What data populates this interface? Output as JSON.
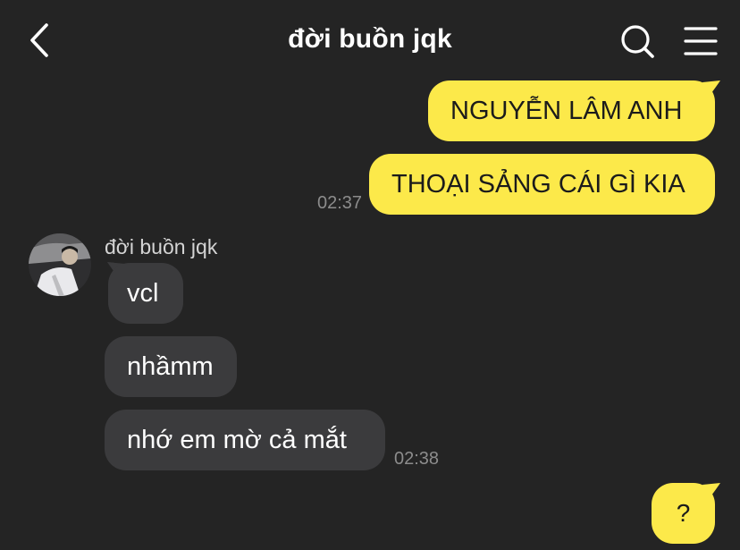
{
  "header": {
    "title": "đời buồn jqk",
    "back_icon": "chevron-left-icon",
    "search_icon": "search-icon",
    "menu_icon": "hamburger-menu-icon"
  },
  "messages": {
    "outgoing": [
      {
        "text": "NGUYỄN LÂM ANH"
      },
      {
        "text": "THOẠI SẢNG CÁI GÌ KIA",
        "time": "02:37"
      }
    ],
    "incoming_sender": "đời buồn jqk",
    "incoming": [
      {
        "text": "vcl"
      },
      {
        "text": "nhầmm"
      },
      {
        "text": "nhớ em mờ cả mắt",
        "time": "02:38"
      }
    ],
    "last_outgoing": {
      "text": "?"
    }
  },
  "colors": {
    "background": "#242424",
    "outgoing_bubble": "#fce94a",
    "incoming_bubble": "#3b3b3d",
    "timestamp": "#8c8c8c"
  }
}
